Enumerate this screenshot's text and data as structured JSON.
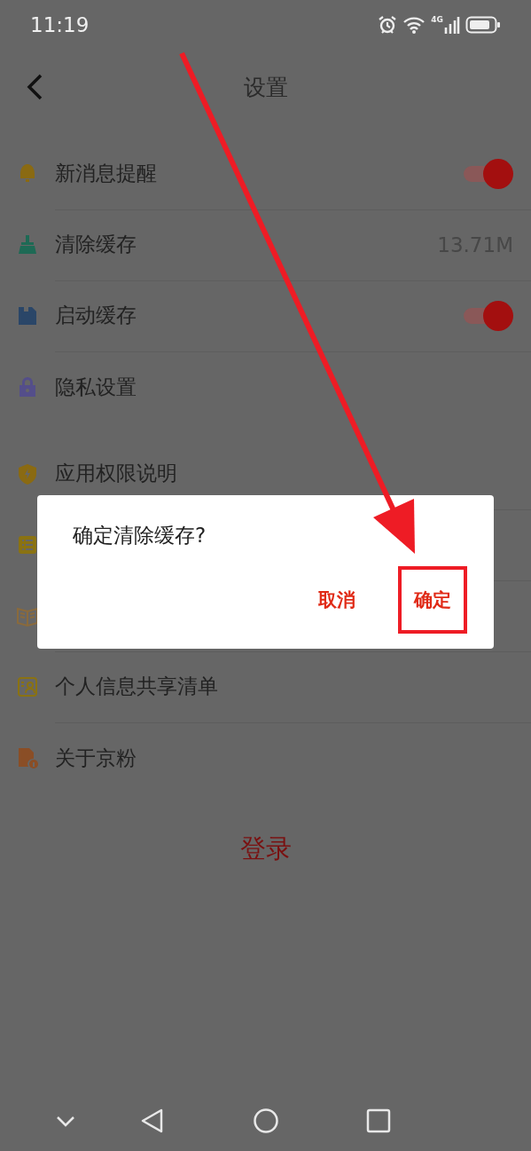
{
  "status_bar": {
    "time": "11:19",
    "network": "4G"
  },
  "header": {
    "title": "设置"
  },
  "groups": [
    [
      {
        "label": "新消息提醒",
        "kind": "toggle",
        "on": true
      },
      {
        "label": "清除缓存",
        "kind": "value",
        "value": "13.71M"
      },
      {
        "label": "启动缓存",
        "kind": "toggle",
        "on": true
      },
      {
        "label": "隐私设置",
        "kind": "link"
      }
    ],
    [
      {
        "label": "应用权限说明",
        "kind": "link"
      },
      {
        "kind": "link"
      },
      {
        "kind": "link"
      },
      {
        "label": "个人信息共享清单",
        "kind": "link"
      },
      {
        "label": "关于京粉",
        "kind": "link"
      }
    ]
  ],
  "login_button": "登录",
  "dialog": {
    "message": "确定清除缓存?",
    "buttons": [
      {
        "label": "取消",
        "highlighted": false
      },
      {
        "label": "确定",
        "highlighted": true
      }
    ]
  }
}
